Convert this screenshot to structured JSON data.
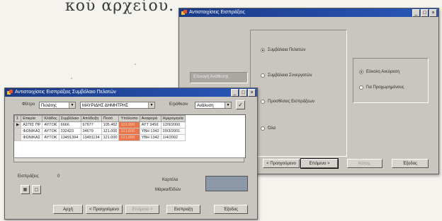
{
  "background_text": "κού αρχείου.",
  "main_window": {
    "title": "Αντιστοιχίσεις  Εισπράξεις",
    "side_label": "Επιλογή Ανάθεσης",
    "options_left": [
      {
        "label": "Συμβόλαια Πελατών",
        "checked": true
      },
      {
        "label": "Συμβόλαια Συνεργατών",
        "checked": false
      },
      {
        "label": "Προσθέσεις Εισπράξεων",
        "checked": false
      },
      {
        "label": "Όλα",
        "checked": false
      }
    ],
    "options_right": [
      {
        "label": "Εύκολη Ανεύρεση",
        "checked": true
      },
      {
        "label": "Για Προχωρημένους",
        "checked": false
      }
    ],
    "buttons": {
      "prev": "< Προηγούμενο",
      "next": "Επόμενο >",
      "finish": "Καταχ.",
      "exit": "Έξοδος"
    }
  },
  "front_window": {
    "title": "Αντιστοιχίσεις  Εισπράξεις  Συμβόλαιο Πελατών",
    "filter_label": "Φίλτρο",
    "filter_value": "Πελάτης",
    "client_value": "ΜΑΥΡΙΔΗΣ ΔΗΜΗΤΡΗΣ",
    "sort_label": "Ε/ρόθεσιν",
    "sort_value": "Ανάλυση",
    "columns": [
      "Εταιρία",
      "Κλάδος",
      "Συμβόλαιο",
      "Απόδειξη",
      "Ποσό",
      "Υπόλοιπο",
      "Αναφορά",
      "Ημερομηνία"
    ],
    "rows": [
      [
        "ΑΣΠΙΣ ΠΡ",
        "ΑΥΤΟΚ",
        "6666",
        "67677",
        "105.462",
        "101.000",
        "ΑΥΤ 3456",
        "12/9/2000"
      ],
      [
        "ΦΩΝΙΚΑΣ",
        "ΑΥΤΟΚ",
        "232423",
        "34679",
        "121.000",
        "121.000",
        "ΥΒΗ 1342",
        "20/3/2001"
      ],
      [
        "ΦΩΝΙΚΑΣ",
        "ΑΥΤΟΚ",
        "13491394",
        "13491134",
        "121.000",
        "121.000",
        "ΥΒΗ 1342",
        "1/4/2002"
      ]
    ],
    "receipts_label": "Εισπράξεις",
    "receipts_value": "0",
    "total_label": "Καρτέλα",
    "balance_label": "Μάρκα/Ειδών",
    "buttons": {
      "start": "Αρχή",
      "prev": "< Προηγούμενο",
      "next": "Επόμενο >",
      "collect": "Εισπραξη",
      "exit": "Έξοδος"
    }
  }
}
